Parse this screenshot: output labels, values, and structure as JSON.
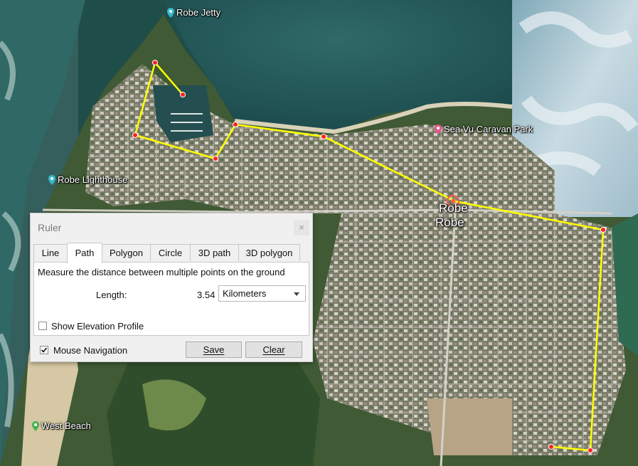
{
  "map": {
    "places": [
      {
        "id": "robe-jetty",
        "label": "Robe Jetty"
      },
      {
        "id": "sea-vu",
        "label": "Sea Vu Caravan Park"
      },
      {
        "id": "robe-lighthouse",
        "label": "Robe Lighthouse"
      },
      {
        "id": "west-beach",
        "label": "West Beach"
      }
    ],
    "town_label_1": "Robe",
    "town_label_2": "Robe",
    "path_color": "#ffff00",
    "vertex_color": "#ff2020"
  },
  "ruler": {
    "title": "Ruler",
    "close_icon": "×",
    "tabs": [
      "Line",
      "Path",
      "Polygon",
      "Circle",
      "3D path",
      "3D polygon"
    ],
    "active_tab": "Path",
    "description": "Measure the distance between multiple points on the ground",
    "length_label": "Length:",
    "length_value": "3.54",
    "unit": "Kilometers",
    "show_elevation_label": "Show Elevation Profile",
    "show_elevation_checked": false,
    "mouse_nav_label": "Mouse Navigation",
    "mouse_nav_checked": true,
    "save_label": "Save",
    "clear_label": "Clear"
  }
}
